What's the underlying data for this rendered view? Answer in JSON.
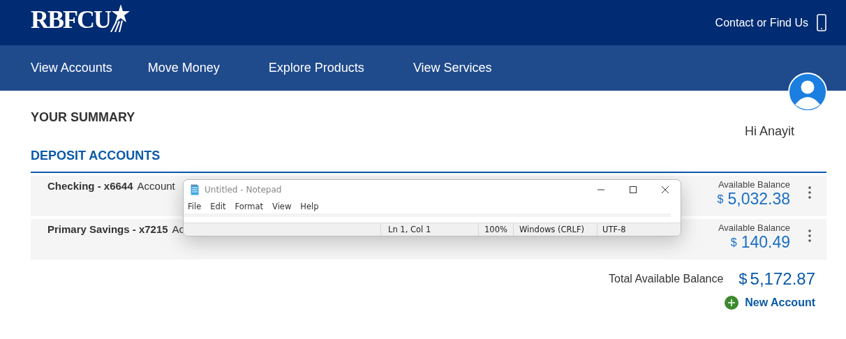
{
  "header": {
    "logo": "RBFCU",
    "contact_link": "Contact or Find Us"
  },
  "nav": [
    {
      "label": "View Accounts"
    },
    {
      "label": "Move Money"
    },
    {
      "label": "Explore Products"
    },
    {
      "label": "View Services"
    }
  ],
  "summary": {
    "title": "YOUR SUMMARY",
    "greeting": "Hi Anayit"
  },
  "deposit_accounts": {
    "title": "DEPOSIT ACCOUNTS",
    "accounts": [
      {
        "name": "Checking - x6644",
        "detail": "Account",
        "balance_label": "Available Balance",
        "currency": "$",
        "balance": "5,032.38"
      },
      {
        "name": "Primary Savings - x7215",
        "detail": "Ac",
        "balance_label": "Available Balance",
        "currency": "$",
        "balance": "140.49"
      }
    ],
    "total_label": "Total Available Balance",
    "total_currency": "$",
    "total": "5,172.87",
    "new_account": "New Account"
  },
  "notepad": {
    "title": "Untitled - Notepad",
    "menu": [
      "File",
      "Edit",
      "Format",
      "View",
      "Help"
    ],
    "status": [
      "Ln 1, Col 1",
      "100%",
      "Windows (CRLF)",
      "UTF-8"
    ]
  }
}
